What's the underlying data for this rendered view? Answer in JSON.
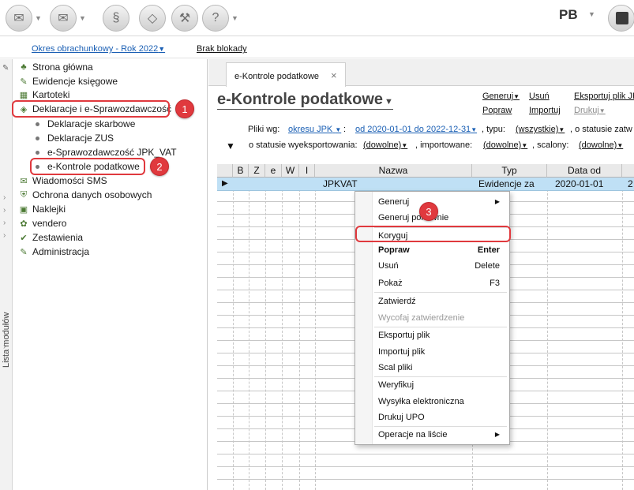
{
  "toolbar": {
    "user_initials": "PB",
    "icons": [
      "mail-icon",
      "envelope-icon",
      "document-stack-icon",
      "eraser-icon",
      "tools-icon",
      "help-icon",
      "box-icon"
    ]
  },
  "period": {
    "label": "Okres obrachunkowy - Rok 2022",
    "lock_status": "Brak blokady"
  },
  "left_strip": {
    "label": "Lista modułów"
  },
  "sidebar": {
    "items": [
      {
        "label": "Strona główna"
      },
      {
        "label": "Ewidencje księgowe"
      },
      {
        "label": "Kartoteki"
      },
      {
        "label": "Deklaracje i e-Sprawozdawczość"
      },
      {
        "label": "Wiadomości SMS"
      },
      {
        "label": "Ochrona danych osobowych"
      },
      {
        "label": "Naklejki"
      },
      {
        "label": "vendero"
      },
      {
        "label": "Zestawienia"
      },
      {
        "label": "Administracja"
      }
    ],
    "subitems": [
      {
        "label": "Deklaracje skarbowe"
      },
      {
        "label": "Deklaracje ZUS"
      },
      {
        "label": "e-Sprawozdawczość JPK_VAT"
      },
      {
        "label": "e-Kontrole podatkowe"
      }
    ]
  },
  "annotations": {
    "step1": "1",
    "step2": "2",
    "step3": "3"
  },
  "tab": {
    "label": "e-Kontrole podatkowe",
    "close": "×"
  },
  "page": {
    "title": "e-Kontrole podatkowe"
  },
  "actions": {
    "generuj": "Generuj",
    "usun": "Usuń",
    "eksportuj": "Eksportuj plik JPK",
    "popraw": "Popraw",
    "importuj": "Importuj",
    "drukuj": "Drukuj"
  },
  "filters": {
    "pliki_label": "Pliki wg:",
    "pliki_value": "okresu JPK",
    "range_value": "od 2020-01-01 do 2022-12-31",
    "typu_label": ", typu:",
    "typu_value": "(wszystkie)",
    "status_label": ", o statusie zatw",
    "export_label": "o statusie wyeksportowania:",
    "export_value": "(dowolne)",
    "import_label": ", importowane:",
    "import_value": "(dowolne)",
    "scalony_label": ", scalony:",
    "scalony_value": "(dowolne)"
  },
  "grid": {
    "columns": [
      "B",
      "Z",
      "e",
      "W",
      "I",
      "Nazwa",
      "Typ",
      "Data od",
      ""
    ],
    "selected_row": {
      "nazwa": "JPKVAT",
      "typ": "Ewidencje za",
      "data_od": "2020-01-01",
      "next": "2"
    }
  },
  "context_menu": {
    "items": [
      {
        "label": "Generuj"
      },
      {
        "label": "Generuj ponownie"
      },
      {
        "label": "Koryguj"
      },
      {
        "label": "Popraw",
        "key": "Enter"
      },
      {
        "label": "Usuń",
        "key": "Delete"
      },
      {
        "label": "Pokaż",
        "key": "F3"
      },
      {
        "label": "Zatwierdź"
      },
      {
        "label": "Wycofaj zatwierdzenie"
      },
      {
        "label": "Eksportuj plik"
      },
      {
        "label": "Importuj plik"
      },
      {
        "label": "Scal pliki"
      },
      {
        "label": "Weryfikuj"
      },
      {
        "label": "Wysyłka elektroniczna"
      },
      {
        "label": "Drukuj UPO"
      },
      {
        "label": "Operacje na liście"
      }
    ]
  },
  "colors": {
    "highlight_red": "#e0393e",
    "link_blue": "#1a5fb4",
    "selected_row": "#bfe0f5"
  }
}
